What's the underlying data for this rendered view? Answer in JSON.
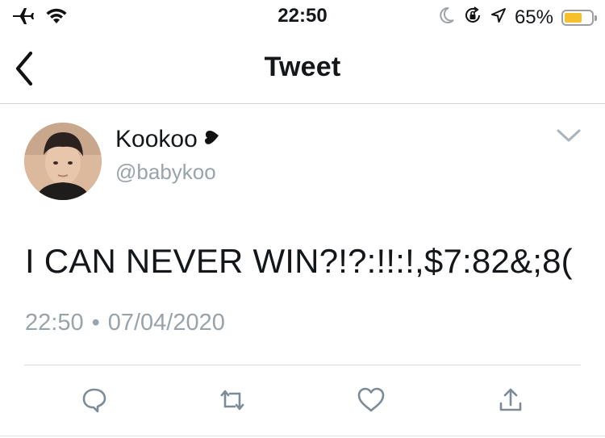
{
  "status_bar": {
    "time": "22:50",
    "battery_percent": "65%",
    "battery_level": 0.65,
    "battery_color": "#f5c02a"
  },
  "nav": {
    "title": "Tweet"
  },
  "tweet": {
    "display_name": "Kookoo",
    "username": "@babykoo",
    "text": "I CAN NEVER WIN?!?:!!:!,$7:82&;8(",
    "time": "22:50",
    "separator": "•",
    "date": "07/04/2020"
  },
  "icons": {
    "status_left": [
      "airplane-icon",
      "wifi-icon"
    ],
    "status_right": [
      "moon-icon",
      "rotation-lock-icon",
      "location-icon",
      "battery-icon"
    ],
    "actions": [
      "reply-icon",
      "retweet-icon",
      "like-icon",
      "share-icon"
    ]
  },
  "colors": {
    "text": "#14171a",
    "secondary": "#98a3ab",
    "icon": "#7b8b97",
    "divider": "#cfd3d6"
  }
}
